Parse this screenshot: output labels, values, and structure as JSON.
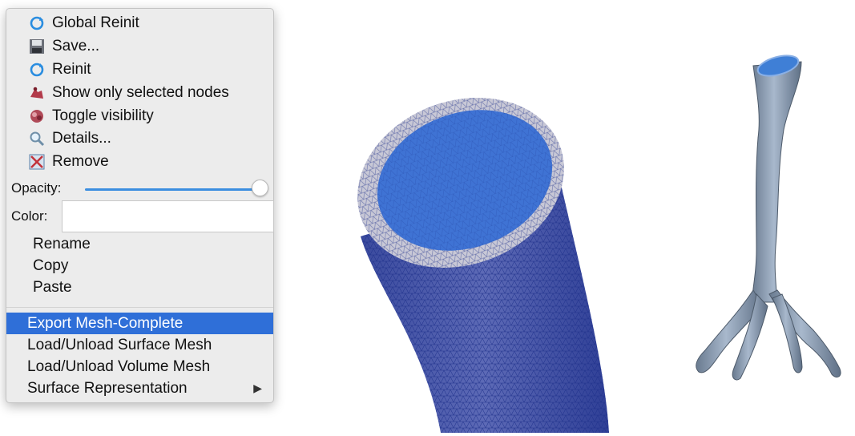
{
  "menu": {
    "items_top": [
      {
        "label": "Global Reinit",
        "icon": "refresh-icon"
      },
      {
        "label": "Save...",
        "icon": "floppy-disk-icon"
      },
      {
        "label": "Reinit",
        "icon": "refresh-icon"
      },
      {
        "label": "Show only selected nodes",
        "icon": "selected-nodes-icon"
      },
      {
        "label": "Toggle visibility",
        "icon": "toggle-visibility-icon"
      },
      {
        "label": "Details...",
        "icon": "magnifier-icon"
      },
      {
        "label": "Remove",
        "icon": "remove-icon"
      }
    ],
    "opacity_label": "Opacity:",
    "opacity_value": 1.0,
    "color_label": "Color:",
    "color_value": "#ffffff",
    "items_edit": [
      "Rename",
      "Copy",
      "Paste"
    ],
    "items_bottom": [
      {
        "label": "Export Mesh-Complete",
        "selected": true
      },
      {
        "label": "Load/Unload Surface Mesh",
        "selected": false
      },
      {
        "label": "Load/Unload Volume Mesh",
        "selected": false
      },
      {
        "label": "Surface Representation",
        "selected": false,
        "submenu": true
      }
    ],
    "submenu_arrow": "▶"
  },
  "colors": {
    "menu_bg": "#ececec",
    "selection": "#2f6fd8",
    "slider": "#3b8ee0",
    "mesh_cap": "#3f73d4",
    "mesh_wall": "#4a5aa8",
    "vessel": "#8f9fb3"
  }
}
